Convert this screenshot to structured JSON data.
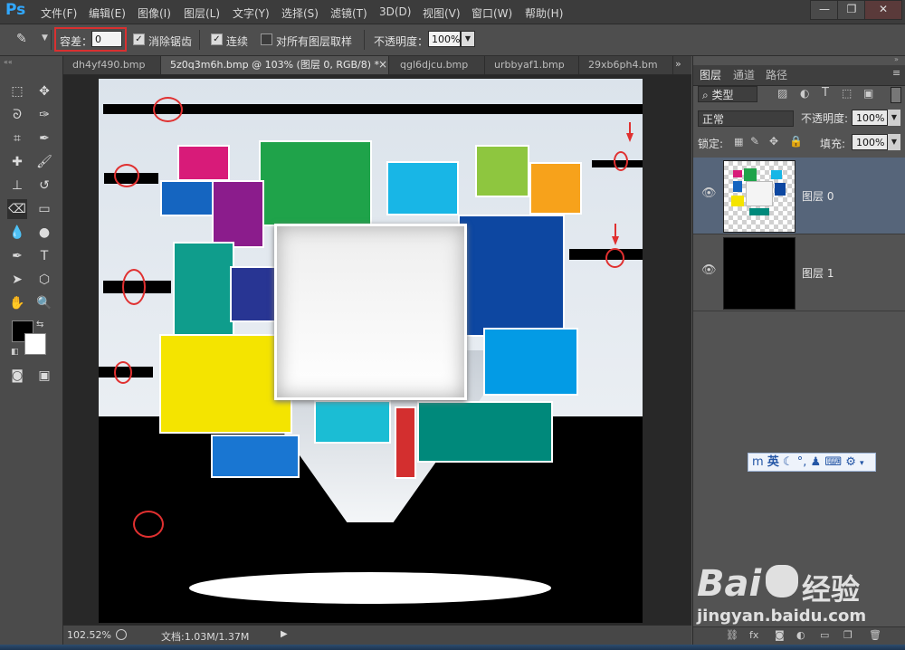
{
  "app": {
    "logo": "Ps"
  },
  "menu": {
    "items": [
      "文件(F)",
      "编辑(E)",
      "图像(I)",
      "图层(L)",
      "文字(Y)",
      "选择(S)",
      "滤镜(T)",
      "3D(D)",
      "视图(V)",
      "窗口(W)",
      "帮助(H)"
    ]
  },
  "window_buttons": {
    "minimize": "—",
    "restore": "❐",
    "close": "✕"
  },
  "options": {
    "tolerance_label": "容差：",
    "tolerance_value": "0",
    "antialias_label": "消除锯齿",
    "contiguous_label": "连续",
    "sample_all_label": "对所有图层取样",
    "opacity_label": "不透明度：",
    "opacity_value": "100%",
    "antialias_checked": true,
    "contiguous_checked": true,
    "sample_all_checked": false
  },
  "tabs": [
    {
      "label": "dh4yf490.bmp"
    },
    {
      "label": "5z0q3m6h.bmp @ 103% (图层 0, RGB/8) *"
    },
    {
      "label": "qgl6djcu.bmp"
    },
    {
      "label": "urbbyaf1.bmp"
    },
    {
      "label": "29xb6ph4.bm"
    }
  ],
  "tab_close": "×",
  "status": {
    "zoom": "102.52%",
    "doc_size": "文档:1.03M/1.37M"
  },
  "layers_panel": {
    "tabs": [
      "图层",
      "通道",
      "路径"
    ],
    "filter_kind": "类型",
    "blend_mode": "正常",
    "opacity_label": "不透明度:",
    "opacity_value": "100%",
    "lock_label": "锁定:",
    "fill_label": "填充:",
    "fill_value": "100%",
    "layers": [
      {
        "name": "图层 0",
        "selected": true
      },
      {
        "name": "图层 1",
        "selected": false
      }
    ]
  },
  "ime_bar": {
    "text": "英"
  },
  "watermark": {
    "brand": "Bai",
    "brand_cn": "经验",
    "url": "jingyan.baidu.com"
  },
  "colors": {
    "accent": "#31a8ff",
    "annotation": "#e03030",
    "selected_layer": "#56657a"
  }
}
